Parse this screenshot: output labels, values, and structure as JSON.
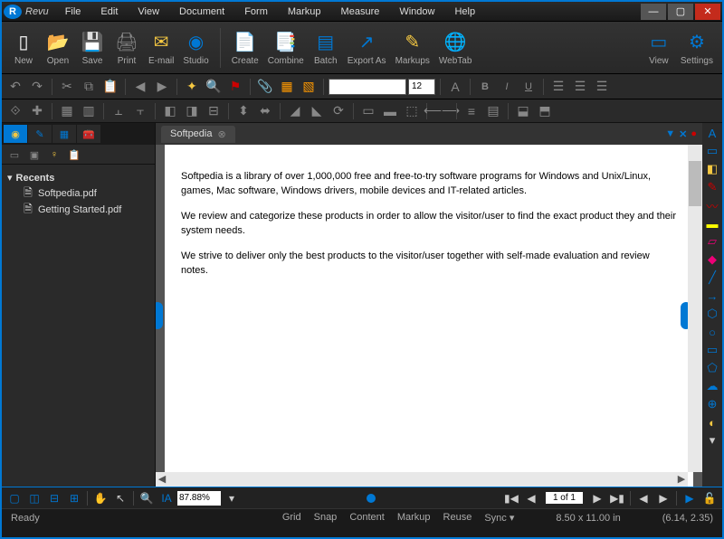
{
  "app": {
    "title": "Revu"
  },
  "menu": [
    "File",
    "Edit",
    "View",
    "Document",
    "Form",
    "Markup",
    "Measure",
    "Window",
    "Help"
  ],
  "ribbon": {
    "left": [
      {
        "id": "new",
        "label": "New",
        "color": "#fff",
        "glyph": "▯"
      },
      {
        "id": "open",
        "label": "Open",
        "color": "#f5c842",
        "glyph": "📂"
      },
      {
        "id": "save",
        "label": "Save",
        "color": "#0078d4",
        "glyph": "💾"
      },
      {
        "id": "print",
        "label": "Print",
        "color": "#888",
        "glyph": "🖨"
      },
      {
        "id": "email",
        "label": "E-mail",
        "color": "#f5c842",
        "glyph": "✉"
      },
      {
        "id": "studio",
        "label": "Studio",
        "color": "#0078d4",
        "glyph": "◉"
      }
    ],
    "mid": [
      {
        "id": "create",
        "label": "Create",
        "color": "#f5c842",
        "glyph": "📄"
      },
      {
        "id": "combine",
        "label": "Combine",
        "color": "#f5c842",
        "glyph": "📑"
      },
      {
        "id": "batch",
        "label": "Batch",
        "color": "#0078d4",
        "glyph": "▤"
      },
      {
        "id": "exportas",
        "label": "Export As",
        "color": "#0078d4",
        "glyph": "↗"
      },
      {
        "id": "markups",
        "label": "Markups",
        "color": "#f5c842",
        "glyph": "✎"
      },
      {
        "id": "webtab",
        "label": "WebTab",
        "color": "#2e8b57",
        "glyph": "🌐"
      }
    ],
    "right": [
      {
        "id": "view",
        "label": "View",
        "color": "#0078d4",
        "glyph": "▭"
      },
      {
        "id": "settings",
        "label": "Settings",
        "color": "#0078d4",
        "glyph": "⚙"
      }
    ]
  },
  "fontsize": "12",
  "sidebar": {
    "header": "Recents",
    "files": [
      {
        "name": "Softpedia.pdf"
      },
      {
        "name": "Getting Started.pdf"
      }
    ]
  },
  "document": {
    "tab": "Softpedia",
    "paragraphs": [
      "Softpedia is a library of over 1,000,000 free and free-to-try software programs for Windows and Unix/Linux, games, Mac software, Windows drivers, mobile devices and IT-related articles.",
      "We review and categorize these products in order to allow the visitor/user to find the exact product they and their system needs.",
      "We strive to deliver only the best products to the visitor/user together with self-made evaluation and review notes."
    ]
  },
  "bottom": {
    "zoom": "87.88%",
    "page": "1 of 1"
  },
  "status": {
    "ready": "Ready",
    "items": [
      "Grid",
      "Snap",
      "Content",
      "Markup",
      "Reuse",
      "Sync ▾"
    ],
    "dims": "8.50 x 11.00 in",
    "coords": "(6.14, 2.35)"
  },
  "rtools": [
    {
      "c": "#0078d4",
      "g": "A"
    },
    {
      "c": "#0078d4",
      "g": "▭"
    },
    {
      "c": "#f5c842",
      "g": "◧"
    },
    {
      "c": "#c00",
      "g": "✎"
    },
    {
      "c": "#c00",
      "g": "〰"
    },
    {
      "c": "#ff0",
      "g": "▬"
    },
    {
      "c": "#e07",
      "g": "▱"
    },
    {
      "c": "#e07",
      "g": "◆"
    },
    {
      "c": "#0078d4",
      "g": "╱"
    },
    {
      "c": "#0078d4",
      "g": "→"
    },
    {
      "c": "#0078d4",
      "g": "⬡"
    },
    {
      "c": "#0078d4",
      "g": "○"
    },
    {
      "c": "#0078d4",
      "g": "▭"
    },
    {
      "c": "#0078d4",
      "g": "⬠"
    },
    {
      "c": "#0078d4",
      "g": "☁"
    },
    {
      "c": "#0078d4",
      "g": "⊕"
    },
    {
      "c": "#f5c842",
      "g": "◐"
    },
    {
      "c": "#ccc",
      "g": "▾"
    }
  ]
}
